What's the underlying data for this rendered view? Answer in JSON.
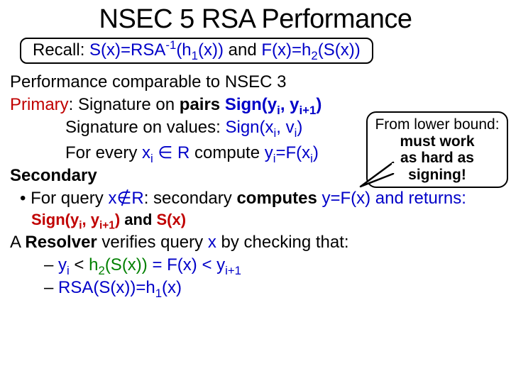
{
  "title": "NSEC 5 RSA Performance",
  "recall": {
    "prefix": "Recall: ",
    "sx": "S(x)=RSA",
    "sup1": "-1",
    "sx2": "(h",
    "sub1": "1",
    "sx3": "(x))",
    "middle": " and ",
    "fx": "F(x)=h",
    "sub2": "2",
    "fx2": "(S(x))"
  },
  "lines": {
    "l1": "Performance comparable to NSEC 3",
    "l2a": "Primary",
    "l2b": ": Signature on ",
    "l2c": "pairs ",
    "l2d": "Sign(y",
    "l2d_sub": "i",
    "l2e": ", y",
    "l2e_sub": "i+1",
    "l2f": ")",
    "l3a": "Signature on values: ",
    "l3b": "Sign(x",
    "l3b_sub": "i",
    "l3c": ", v",
    "l3c_sub": "i",
    "l3d": ")",
    "l4a": "For every ",
    "l4b": "x",
    "l4b_sub": "i",
    "l4c": " ∈ R",
    "l4d": " compute ",
    "l4e": "y",
    "l4e_sub": "i",
    "l4f": "=F(x",
    "l4f_sub": "i",
    "l4g": ")",
    "l5": "Secondary",
    "l6a": "•  For query ",
    "l6b": "x∉R",
    "l6c": ": secondary ",
    "l6d": "computes ",
    "l6e": "y=F(x)",
    "l6f": " and returns:",
    "l7a": "Sign(y",
    "l7a_sub": "i",
    "l7b": ", y",
    "l7b_sub": "i+1",
    "l7c": ") ",
    "l7d": "and ",
    "l7e": "S(x)",
    "l8a": "A ",
    "l8b": "Resolver ",
    "l8c": "verifies query ",
    "l8d": "x",
    "l8e": " by checking that:",
    "l9a": "– ",
    "l9b": "y",
    "l9b_sub": "i",
    "l9c": " < ",
    "l9d": "h",
    "l9d_sub": "2",
    "l9e": "(S(x))",
    "l9f": " = F(x) < ",
    "l9g": "y",
    "l9g_sub": "i+1",
    "l10a": "– ",
    "l10b": "RSA(S(x))=h",
    "l10b_sub": "1",
    "l10c": "(x)"
  },
  "callout": {
    "line1": "From lower bound:",
    "line2": "must work",
    "line3": "as hard as signing!"
  }
}
